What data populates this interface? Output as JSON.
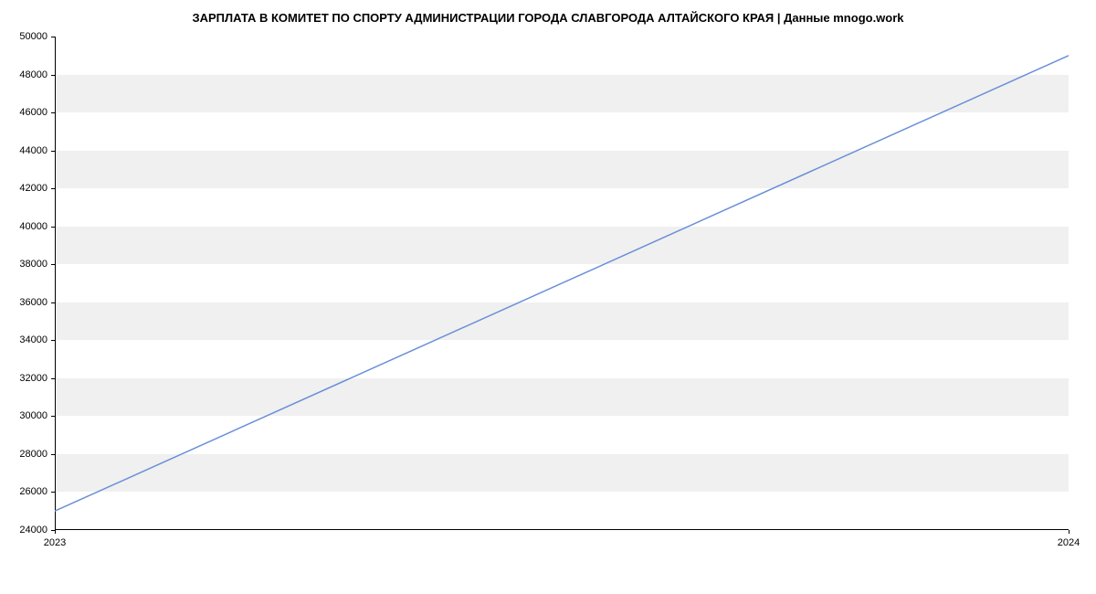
{
  "chart_data": {
    "type": "line",
    "title": "ЗАРПЛАТА В КОМИТЕТ ПО СПОРТУ АДМИНИСТРАЦИИ ГОРОДА СЛАВГОРОДА АЛТАЙСКОГО КРАЯ | Данные mnogo.work",
    "x": [
      2023,
      2024
    ],
    "values": [
      25000,
      49000
    ],
    "xlabel": "",
    "ylabel": "",
    "ylim": [
      24000,
      50000
    ],
    "xlim": [
      2023,
      2024
    ],
    "x_ticks": [
      2023,
      2024
    ],
    "y_ticks": [
      24000,
      26000,
      28000,
      30000,
      32000,
      34000,
      36000,
      38000,
      40000,
      42000,
      44000,
      46000,
      48000,
      50000
    ],
    "line_color": "#6a8fd8"
  }
}
